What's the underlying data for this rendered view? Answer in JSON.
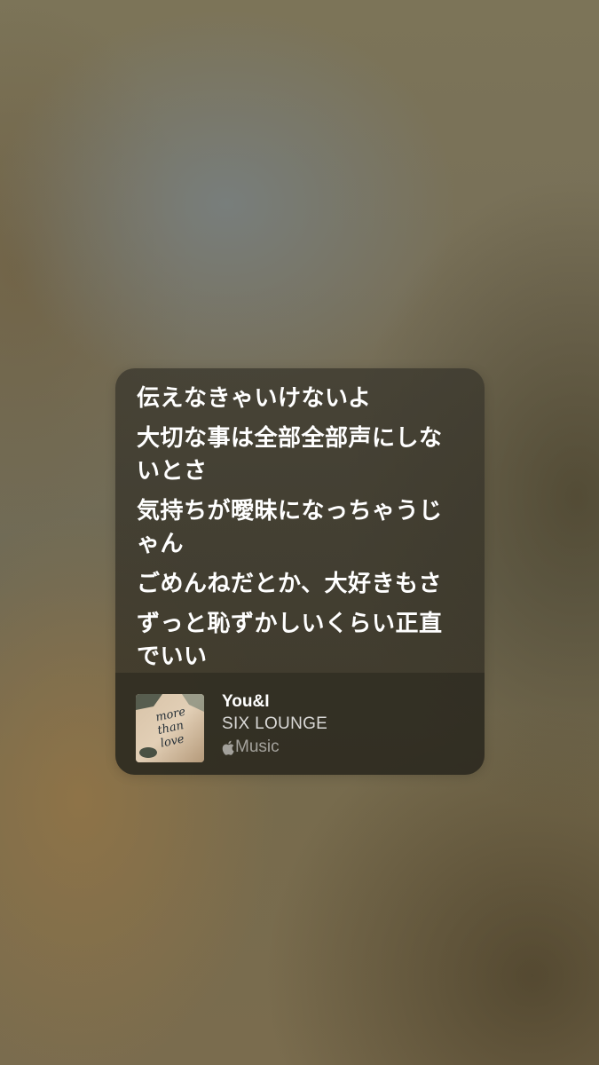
{
  "lyrics": [
    "伝えなきゃいけないよ",
    "大切な事は全部全部声にしないとさ",
    "気持ちが曖昧になっちゃうじゃん",
    "ごめんねだとか、大好きもさ",
    "ずっと恥ずかしいくらい正直でいい"
  ],
  "track": {
    "title": "You&I",
    "artist": "SIX LOUNGE",
    "service": "Music",
    "service_icon": "apple-logo-icon",
    "artwork_text": [
      "more",
      "than",
      "love"
    ]
  },
  "colors": {
    "card_bg": "#3a372d",
    "text": "#ffffff"
  }
}
